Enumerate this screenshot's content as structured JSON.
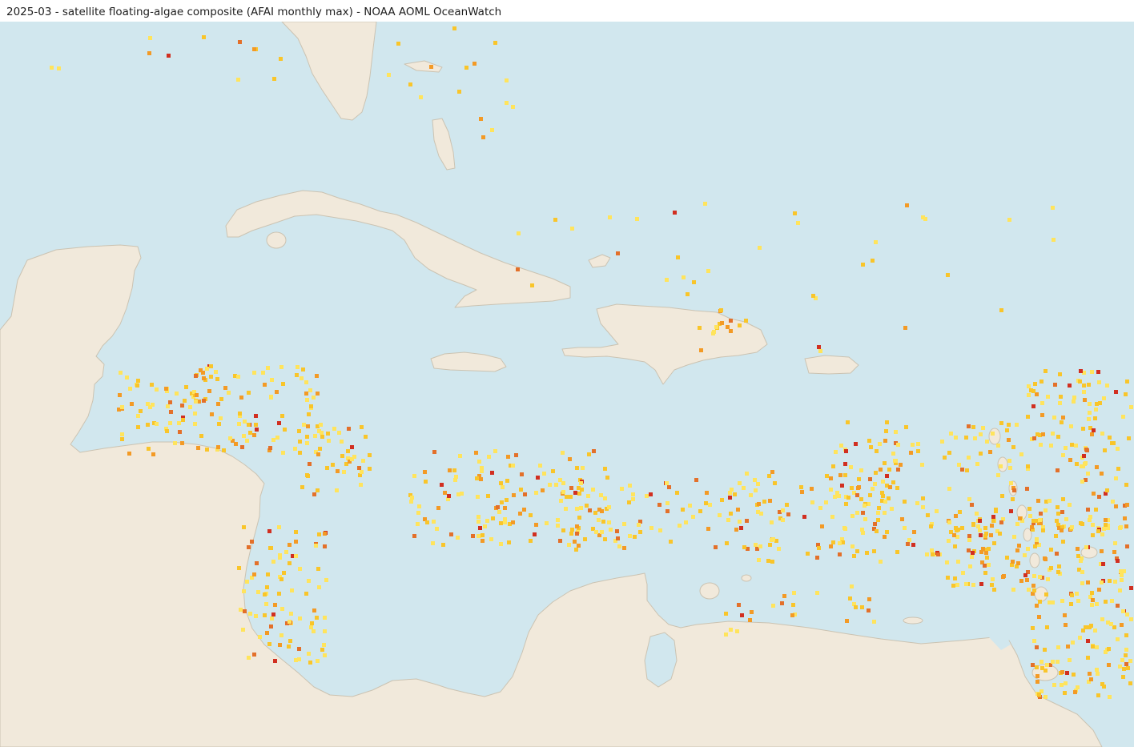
{
  "map": {
    "title": "2025-03 - satellite floating-algae composite (AFAI monthly max) - NOAA AOML OceanWatch",
    "colors": {
      "ocean": "#d1e7ee",
      "land": "#f1e9db",
      "coast": "#cbc3b2",
      "algae_scale": [
        "#ffe45c",
        "#f9c52a",
        "#f39a25",
        "#e3702a",
        "#d12f20"
      ]
    },
    "layers": [
      "ocean",
      "land",
      "floating-algae-pixels"
    ]
  }
}
